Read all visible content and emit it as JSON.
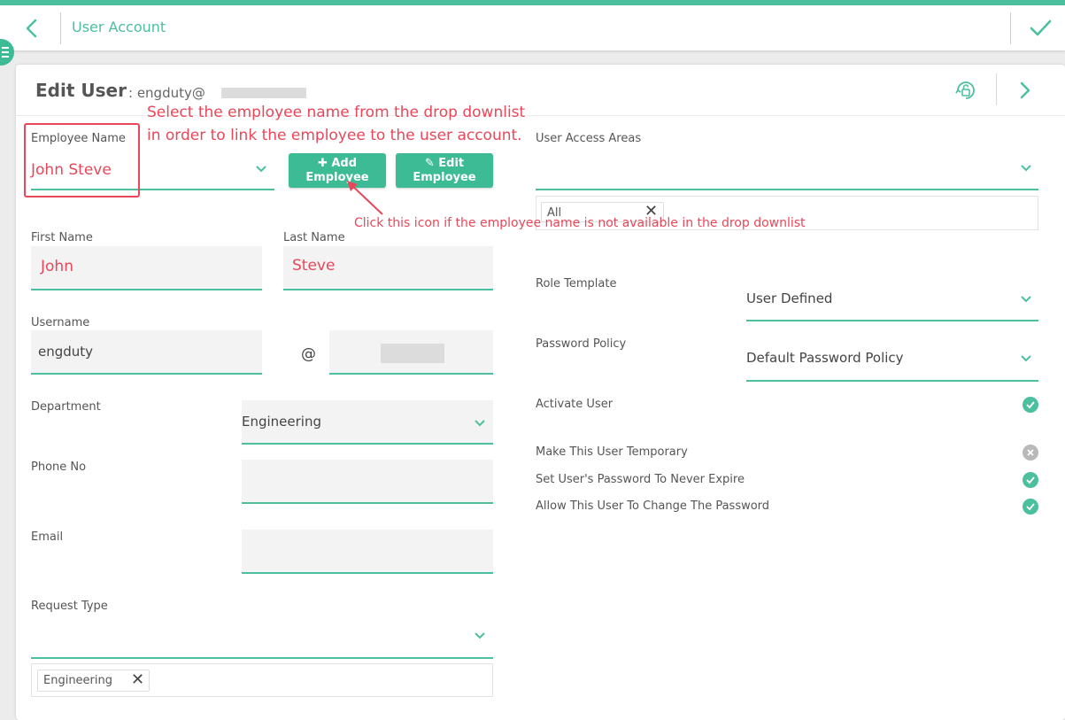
{
  "header": {
    "title": "User Account"
  },
  "card": {
    "title": "Edit User",
    "subtitle": ": engduty@"
  },
  "form": {
    "employee_name": {
      "label": "Employee Name",
      "value": "John Steve"
    },
    "add_employee_label": [
      "✚ Add",
      "Employee"
    ],
    "edit_employee_label": [
      "✎ Edit",
      "Employee"
    ],
    "first_name": {
      "label": "First Name",
      "value": "John"
    },
    "last_name": {
      "label": "Last Name",
      "value": "Steve"
    },
    "username": {
      "label": "Username",
      "value": "engduty",
      "at": "@"
    },
    "department": {
      "label": "Department",
      "value": "Engineering"
    },
    "phone": {
      "label": "Phone No",
      "value": ""
    },
    "email": {
      "label": "Email",
      "value": ""
    },
    "request_type": {
      "label": "Request Type",
      "chip": "Engineering"
    },
    "user_access_areas": {
      "label": "User Access Areas",
      "chip": "All"
    },
    "role_template": {
      "label": "Role Template",
      "value": "User Defined"
    },
    "password_policy": {
      "label": "Password Policy",
      "value": "Default Password Policy"
    },
    "toggles": [
      {
        "label": "Activate User",
        "state": "on"
      },
      {
        "label": "Make This User Temporary",
        "state": "off"
      },
      {
        "label": "Set User's Password To Never Expire",
        "state": "on"
      },
      {
        "label": "Allow This User To Change The Password",
        "state": "on"
      }
    ]
  },
  "annotations": {
    "main_line1": "Select the employee name from the drop downlist",
    "main_line2": "in order to link the employee to the user account.",
    "icon_note": "Click this icon if the employee name is not available in the drop downlist"
  },
  "colors": {
    "accent": "#4cbf9f",
    "annotation": "#e8475a",
    "toggle_off": "#b9b9b9"
  }
}
